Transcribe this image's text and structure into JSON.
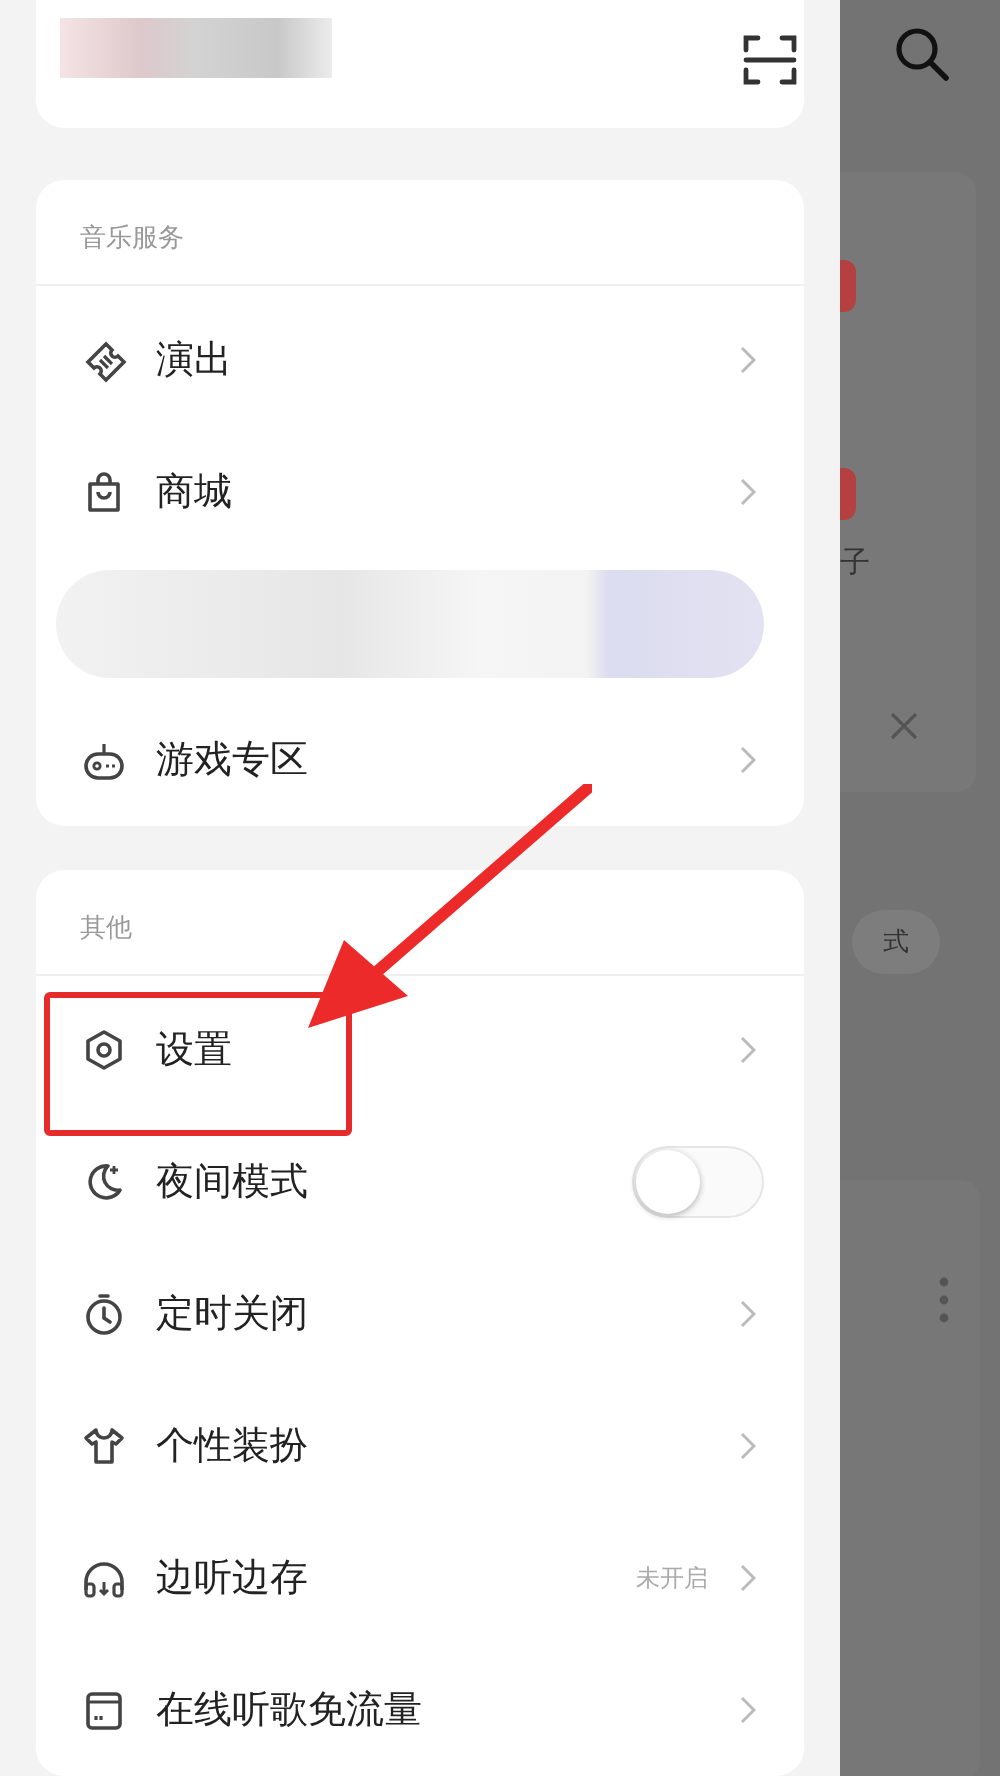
{
  "drawer": {
    "sections": [
      {
        "title": "音乐服务",
        "items": [
          {
            "kind": "link",
            "label": "演出",
            "highlighted": false
          },
          {
            "kind": "link",
            "label": "商城",
            "highlighted": false
          },
          {
            "kind": "banner"
          },
          {
            "kind": "link",
            "label": "游戏专区",
            "highlighted": false
          }
        ]
      },
      {
        "title": "其他",
        "items": [
          {
            "kind": "link",
            "label": "设置",
            "highlighted": true
          },
          {
            "kind": "toggle",
            "label": "夜间模式",
            "on": false,
            "highlighted": false
          },
          {
            "kind": "link",
            "label": "定时关闭",
            "highlighted": false
          },
          {
            "kind": "link",
            "label": "个性装扮",
            "highlighted": false
          },
          {
            "kind": "link",
            "label": "边听边存",
            "value": "未开启",
            "highlighted": false
          },
          {
            "kind": "link",
            "label": "在线听歌免流量",
            "highlighted": false
          }
        ]
      }
    ]
  },
  "background": {
    "texts": [
      "子",
      "式"
    ]
  }
}
